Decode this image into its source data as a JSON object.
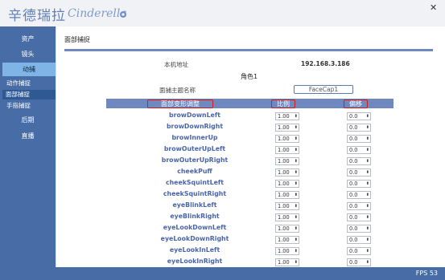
{
  "app": {
    "brand_cn": "辛德瑞拉",
    "brand_en": "Cinderella",
    "close_glyph": "✕",
    "fps_label": "FPS  53"
  },
  "sidebar": {
    "items": [
      "资产",
      "镜头",
      "动捕",
      "后期",
      "直播"
    ],
    "subitems": [
      "动作捕捉",
      "面部捕捉",
      "手指捕捉"
    ]
  },
  "main": {
    "panel_title": "面部捕捉",
    "local_ip_label": "本机地址",
    "local_ip_value": "192.168.3.186",
    "role_title": "角色1",
    "topic_label": "面捕主题名称",
    "topic_value": "FaceCap1",
    "table_headers": [
      "面部变形调整",
      "比例",
      "偏移"
    ],
    "rows": [
      {
        "name": "browDownLeft",
        "scale": "1.00",
        "offset": "0.0"
      },
      {
        "name": "browDownRight",
        "scale": "1.00",
        "offset": "0.0"
      },
      {
        "name": "browInnerUp",
        "scale": "1.00",
        "offset": "0.0"
      },
      {
        "name": "browOuterUpLeft",
        "scale": "1.00",
        "offset": "0.0"
      },
      {
        "name": "browOuterUpRight",
        "scale": "1.00",
        "offset": "0.0"
      },
      {
        "name": "cheekPuff",
        "scale": "1.00",
        "offset": "0.0"
      },
      {
        "name": "cheekSquintLeft",
        "scale": "1.00",
        "offset": "0.0"
      },
      {
        "name": "cheekSquintRight",
        "scale": "1.00",
        "offset": "0.0"
      },
      {
        "name": "eyeBlinkLeft",
        "scale": "1.00",
        "offset": "0.0"
      },
      {
        "name": "eyeBlinkRight",
        "scale": "1.00",
        "offset": "0.0"
      },
      {
        "name": "eyeLookDownLeft",
        "scale": "1.00",
        "offset": "0.0"
      },
      {
        "name": "eyeLookDownRight",
        "scale": "1.00",
        "offset": "0.0"
      },
      {
        "name": "eyeLookInLeft",
        "scale": "1.00",
        "offset": "0.0"
      },
      {
        "name": "eyeLookInRight",
        "scale": "1.00",
        "offset": "0.0"
      }
    ]
  },
  "colors": {
    "sidebar": "#486ca6",
    "active_nav": "#7fb4e6",
    "accent": "#6f88bf",
    "highlight": "#d71b1b"
  }
}
